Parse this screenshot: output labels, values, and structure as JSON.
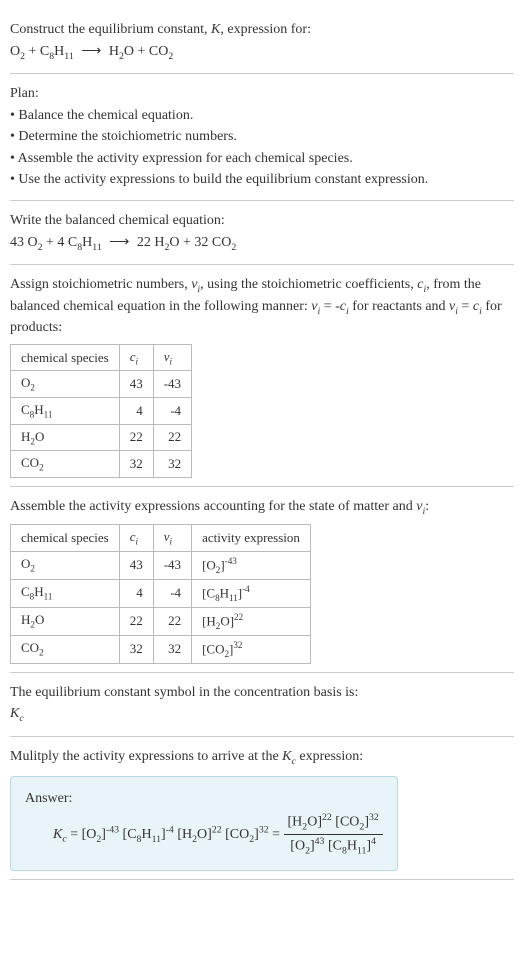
{
  "prompt": {
    "line1_pre": "Construct the equilibrium constant, ",
    "line1_K": "K",
    "line1_post": ", expression for:",
    "eq_lhs1": "O",
    "eq_lhs1_sub": "2",
    "eq_plus1": " + C",
    "eq_lhs2_sub1": "8",
    "eq_lhs2_h": "H",
    "eq_lhs2_sub2": "11",
    "eq_arrow": "⟶",
    "eq_rhs1": "H",
    "eq_rhs1_sub": "2",
    "eq_rhs1_o": "O + CO",
    "eq_rhs2_sub": "2"
  },
  "plan": {
    "title": "Plan:",
    "b1": "• Balance the chemical equation.",
    "b2": "• Determine the stoichiometric numbers.",
    "b3": "• Assemble the activity expression for each chemical species.",
    "b4": "• Use the activity expressions to build the equilibrium constant expression."
  },
  "balanced": {
    "title": "Write the balanced chemical equation:",
    "c1": "43 O",
    "c1sub": "2",
    "plus1": " + 4 C",
    "c2sub1": "8",
    "c2h": "H",
    "c2sub2": "11",
    "arrow": "⟶",
    "c3": "22 H",
    "c3sub": "2",
    "c3o": "O + 32 CO",
    "c4sub": "2"
  },
  "stoich": {
    "intro1": "Assign stoichiometric numbers, ",
    "nu": "ν",
    "i": "i",
    "intro2": ", using the stoichiometric coefficients, ",
    "c": "c",
    "intro3": ", from the balanced chemical equation in the following manner: ",
    "rel1a": " = -",
    "rel1b": " for reactants and ",
    "rel2a": " = ",
    "rel2b": " for products:",
    "table": {
      "h1": "chemical species",
      "h2": "c",
      "h3": "ν",
      "rows": [
        {
          "sp_a": "O",
          "sp_sub": "2",
          "sp_b": "",
          "c": "43",
          "nu": "-43"
        },
        {
          "sp_a": "C",
          "sp_sub": "8",
          "sp_b": "H",
          "sp_sub2": "11",
          "c": "4",
          "nu": "-4"
        },
        {
          "sp_a": "H",
          "sp_sub": "2",
          "sp_b": "O",
          "c": "22",
          "nu": "22"
        },
        {
          "sp_a": "CO",
          "sp_sub": "2",
          "sp_b": "",
          "c": "32",
          "nu": "32"
        }
      ]
    }
  },
  "activity": {
    "intro1": "Assemble the activity expressions accounting for the state of matter and ",
    "intro2": ":",
    "table": {
      "h1": "chemical species",
      "h2": "c",
      "h3": "ν",
      "h4": "activity expression",
      "rows": [
        {
          "sp_a": "O",
          "sp_sub": "2",
          "sp_b": "",
          "c": "43",
          "nu": "-43",
          "ae_base": "[O",
          "ae_sub": "2",
          "ae_close": "]",
          "ae_sup": "-43"
        },
        {
          "sp_a": "C",
          "sp_sub": "8",
          "sp_b": "H",
          "sp_sub2": "11",
          "c": "4",
          "nu": "-4",
          "ae_base": "[C",
          "ae_sub": "8",
          "ae_mid": "H",
          "ae_sub2": "11",
          "ae_close": "]",
          "ae_sup": "-4"
        },
        {
          "sp_a": "H",
          "sp_sub": "2",
          "sp_b": "O",
          "c": "22",
          "nu": "22",
          "ae_base": "[H",
          "ae_sub": "2",
          "ae_mid": "O]",
          "ae_sup": "22"
        },
        {
          "sp_a": "CO",
          "sp_sub": "2",
          "sp_b": "",
          "c": "32",
          "nu": "32",
          "ae_base": "[CO",
          "ae_sub": "2",
          "ae_close": "]",
          "ae_sup": "32"
        }
      ]
    }
  },
  "symbol": {
    "line1": "The equilibrium constant symbol in the concentration basis is:",
    "K": "K",
    "csub": "c"
  },
  "multiply": {
    "line1a": "Mulitply the activity expressions to arrive at the ",
    "K": "K",
    "csub": "c",
    "line1b": " expression:"
  },
  "answer": {
    "label": "Answer:",
    "Kc_K": "K",
    "Kc_c": "c",
    "eq": " = ",
    "t1": "[O",
    "t1sub": "2",
    "t1close": "]",
    "t1sup": "-43",
    "t2": " [C",
    "t2sub": "8",
    "t2h": "H",
    "t2sub2": "11",
    "t2close": "]",
    "t2sup": "-4",
    "t3": " [H",
    "t3sub": "2",
    "t3o": "O]",
    "t3sup": "22",
    "t4": " [CO",
    "t4sub": "2",
    "t4close": "]",
    "t4sup": "32",
    "eq2": " = ",
    "num1": "[H",
    "num1sub": "2",
    "num1o": "O]",
    "num1sup": "22",
    "num2": " [CO",
    "num2sub": "2",
    "num2close": "]",
    "num2sup": "32",
    "den1": "[O",
    "den1sub": "2",
    "den1close": "]",
    "den1sup": "43",
    "den2": " [C",
    "den2sub": "8",
    "den2h": "H",
    "den2sub2": "11",
    "den2close": "]",
    "den2sup": "4"
  },
  "chart_data": {
    "type": "table",
    "tables": [
      {
        "title": "Stoichiometric numbers",
        "columns": [
          "chemical species",
          "c_i",
          "ν_i"
        ],
        "rows": [
          [
            "O2",
            43,
            -43
          ],
          [
            "C8H11",
            4,
            -4
          ],
          [
            "H2O",
            22,
            22
          ],
          [
            "CO2",
            32,
            32
          ]
        ]
      },
      {
        "title": "Activity expressions",
        "columns": [
          "chemical species",
          "c_i",
          "ν_i",
          "activity expression"
        ],
        "rows": [
          [
            "O2",
            43,
            -43,
            "[O2]^-43"
          ],
          [
            "C8H11",
            4,
            -4,
            "[C8H11]^-4"
          ],
          [
            "H2O",
            22,
            22,
            "[H2O]^22"
          ],
          [
            "CO2",
            32,
            32,
            "[CO2]^32"
          ]
        ]
      }
    ],
    "balanced_equation": "43 O2 + 4 C8H11 ⟶ 22 H2O + 32 CO2",
    "Kc": "([H2O]^22 [CO2]^32) / ([O2]^43 [C8H11]^4)"
  }
}
